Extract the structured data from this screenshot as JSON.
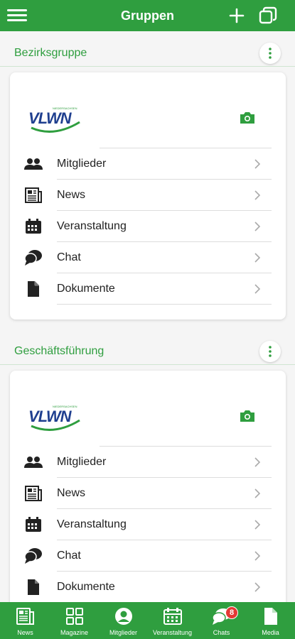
{
  "header": {
    "title": "Gruppen",
    "menu_icon": "hamburger-menu-icon",
    "add_icon": "plus-icon",
    "copy_icon": "copy-icon"
  },
  "groups": [
    {
      "name": "Bezirksgruppe",
      "logo_text": "VLWN",
      "logo_subtext": "NIEDERSACHSEN",
      "items": [
        {
          "label": "Mitglieder",
          "icon": "people-icon"
        },
        {
          "label": "News",
          "icon": "newspaper-icon"
        },
        {
          "label": "Veranstaltung",
          "icon": "calendar-icon"
        },
        {
          "label": "Chat",
          "icon": "chat-bubbles-icon"
        },
        {
          "label": "Dokumente",
          "icon": "document-icon"
        }
      ]
    },
    {
      "name": "Geschäftsführung",
      "logo_text": "VLWN",
      "logo_subtext": "NIEDERSACHSEN",
      "items": [
        {
          "label": "Mitglieder",
          "icon": "people-icon"
        },
        {
          "label": "News",
          "icon": "newspaper-icon"
        },
        {
          "label": "Veranstaltung",
          "icon": "calendar-icon"
        },
        {
          "label": "Chat",
          "icon": "chat-bubbles-icon"
        },
        {
          "label": "Dokumente",
          "icon": "document-icon"
        }
      ]
    }
  ],
  "bottom_nav": [
    {
      "label": "News",
      "icon": "newspaper-icon"
    },
    {
      "label": "Magazine",
      "icon": "grid-icon"
    },
    {
      "label": "Mitglieder",
      "icon": "person-icon"
    },
    {
      "label": "Veranstaltung",
      "icon": "calendar-icon"
    },
    {
      "label": "Chats",
      "icon": "chat-bubbles-icon",
      "badge": "8"
    },
    {
      "label": "Media",
      "icon": "document-icon"
    }
  ],
  "colors": {
    "primary": "#2f9e3f",
    "badge": "#e53935",
    "logo_blue": "#1f3f8f"
  }
}
